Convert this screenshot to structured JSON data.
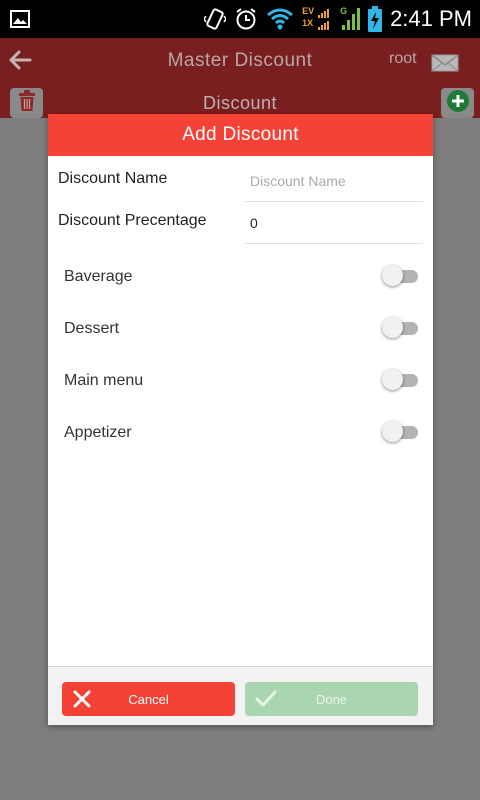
{
  "status_bar": {
    "time": "2:41 PM",
    "network_label_top": "EV",
    "network_label_bottom": "1X",
    "signal_label": "G"
  },
  "app_bar": {
    "title": "Master Discount",
    "user": "root"
  },
  "sub_bar": {
    "title": "Discount"
  },
  "dialog": {
    "title": "Add Discount",
    "fields": {
      "name_label": "Discount Name",
      "name_value": "",
      "name_placeholder": "Discount Name",
      "percentage_label": "Discount Precentage",
      "percentage_value": "0"
    },
    "toggles": [
      {
        "label": "Baverage",
        "on": false
      },
      {
        "label": "Dessert",
        "on": false
      },
      {
        "label": "Main menu",
        "on": false
      },
      {
        "label": "Appetizer",
        "on": false
      }
    ],
    "cancel_label": "Cancel",
    "done_label": "Done"
  },
  "colors": {
    "accent": "#f44336",
    "appbar_dimmed": "#7a1f1f",
    "done_disabled": "#a9d6b0",
    "overlay": "#7e7e7e"
  },
  "icons": {
    "back": "arrow-left-icon",
    "mail": "mail-icon",
    "trash": "trash-icon",
    "add": "plus-circle-icon",
    "cancel": "close-icon",
    "done": "check-icon"
  }
}
